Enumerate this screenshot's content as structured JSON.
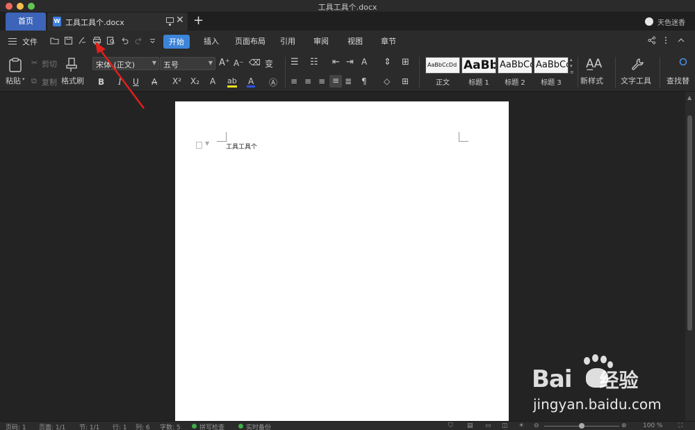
{
  "window": {
    "title": "工具工具个.docx"
  },
  "tabs": {
    "home_label": "首页",
    "doc_label": "工具工具个.docx",
    "doc_icon": "W",
    "close_glyph": "✕",
    "add_glyph": "+"
  },
  "user": {
    "name": "天色迷香"
  },
  "menubar": {
    "file_label": "文件",
    "tabs": [
      "开始",
      "插入",
      "页面布局",
      "引用",
      "审阅",
      "视图",
      "章节"
    ],
    "active_tab": "开始"
  },
  "ribbon": {
    "paste": "粘贴",
    "cut": "剪切",
    "copy": "复制",
    "format_painter": "格式刷",
    "font_name": "宋体 (正文)",
    "font_size": "五号",
    "styles": [
      {
        "preview": "AaBbCcDd",
        "label": "正文"
      },
      {
        "preview": "AaBb",
        "label": "标题 1"
      },
      {
        "preview": "AaBbCc",
        "label": "标题 2"
      },
      {
        "preview": "AaBbCc",
        "label": "标题 3"
      }
    ],
    "new_style": "新样式",
    "text_tools": "文字工具",
    "find_replace": "查找替",
    "colors": {
      "highlight": "#f2e11a",
      "font_color": "#2b54e0",
      "accent": "#3c84d8"
    }
  },
  "document": {
    "body_text": "工具工具个"
  },
  "statusbar": {
    "page_num": "页码: 1",
    "pages": "页面: 1/1",
    "section": "节: 1/1",
    "row": "行: 1",
    "col": "列: 6",
    "word_count": "字数: 5",
    "spell_check": "拼写检查",
    "backup": "实时备份",
    "zoom": "100 %",
    "zoom_fraction": 0.5
  },
  "watermark": {
    "brand": "Bai",
    "brand_zh": "经验",
    "url": "jingyan.baidu.com"
  },
  "annotation": {
    "color": "#e0201b",
    "target": "print-icon"
  }
}
